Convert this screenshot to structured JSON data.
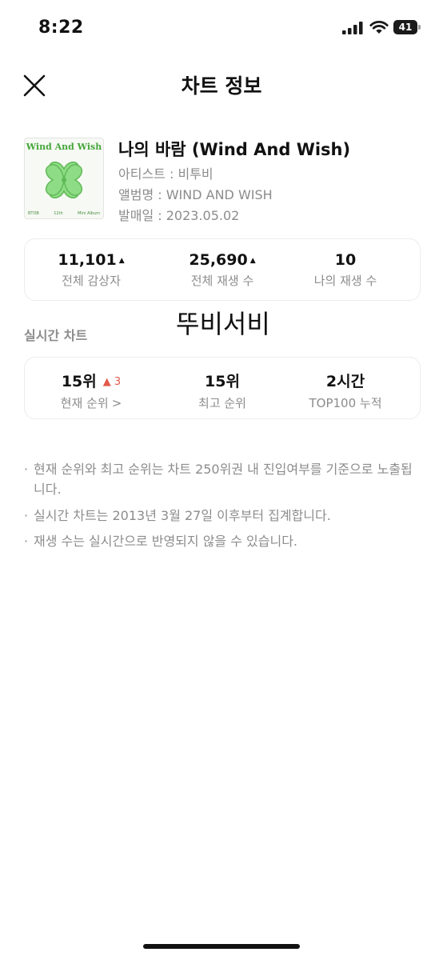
{
  "status_bar": {
    "time": "8:22",
    "battery": "41"
  },
  "header": {
    "title": "차트 정보"
  },
  "song": {
    "title": "나의 바람 (Wind And Wish)",
    "artist": "아티스트 : 비투비",
    "album": "앨범명 : WIND AND WISH",
    "release": "발매일 : 2023.05.02",
    "album_art_title": "Wind And Wish",
    "album_art_footer": [
      "BTOB",
      "12th",
      "Mini Album"
    ]
  },
  "totals": [
    {
      "value": "11,101",
      "trend": "up",
      "label": "전체 감상자"
    },
    {
      "value": "25,690",
      "trend": "up",
      "label": "전체 재생 수"
    },
    {
      "value": "10",
      "trend": "",
      "label": "나의 재생 수"
    }
  ],
  "overlay_text": "뚜비서비",
  "realtime": {
    "section_title": "실시간 차트",
    "current_rank": "15위",
    "rank_change": "▲ 3",
    "current_label": "현재 순위",
    "best_rank": "15위",
    "best_label": "최고 순위",
    "top100_hours": "2시간",
    "top100_label": "TOP100 누적"
  },
  "notes": [
    "현재 순위와 최고 순위는 차트 250위권 내 진입여부를 기준으로 노출됩니다.",
    "실시간 차트는 2013년 3월 27일 이후부터 집계합니다.",
    "재생 수는 실시간으로 반영되지 않을 수 있습니다."
  ],
  "colors": {
    "accent_green": "#46a73c",
    "rank_up": "#e05a4b",
    "muted_text": "#8c8c8c"
  }
}
